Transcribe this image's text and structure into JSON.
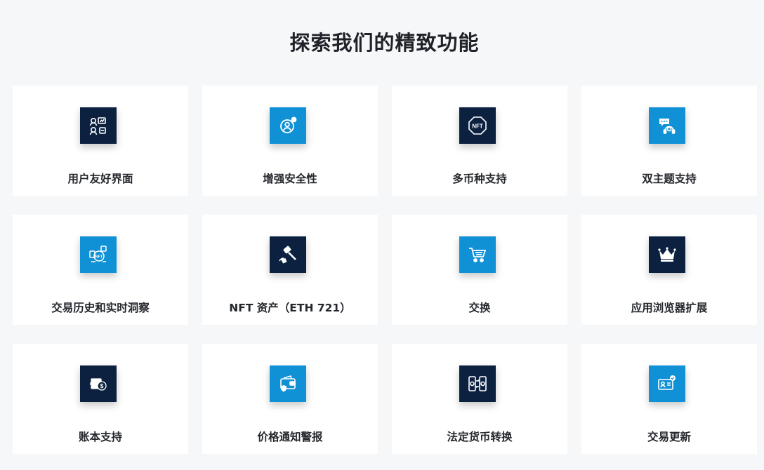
{
  "heading": "探索我们的精致功能",
  "colors": {
    "dark_icon_bg": "#0b213f",
    "blue_icon_bg": "#1091d6",
    "page_bg": "#f6f7f9",
    "card_bg": "#ffffff"
  },
  "features": [
    {
      "label": "用户友好界面",
      "icon": "user-friendly-interface-icon",
      "color": "dark"
    },
    {
      "label": "增强安全性",
      "icon": "security-shield-icon",
      "color": "blue"
    },
    {
      "label": "多币种支持",
      "icon": "nft-badge-icon",
      "color": "dark"
    },
    {
      "label": "双主题支持",
      "icon": "chat-support-icon",
      "color": "blue"
    },
    {
      "label": "交易历史和实时洞察",
      "icon": "nft-history-icon",
      "color": "blue"
    },
    {
      "label": "NFT 资产（ETH 721）",
      "icon": "auction-hammer-icon",
      "color": "dark"
    },
    {
      "label": "交换",
      "icon": "shopping-cart-icon",
      "color": "blue"
    },
    {
      "label": "应用浏览器扩展",
      "icon": "crown-icon",
      "color": "dark"
    },
    {
      "label": "账本支持",
      "icon": "coin-stack-icon",
      "color": "dark"
    },
    {
      "label": "价格通知警报",
      "icon": "wallet-alert-icon",
      "color": "blue"
    },
    {
      "label": "法定货币转换",
      "icon": "currency-exchange-icon",
      "color": "dark"
    },
    {
      "label": "交易更新",
      "icon": "verified-id-card-icon",
      "color": "blue"
    }
  ]
}
